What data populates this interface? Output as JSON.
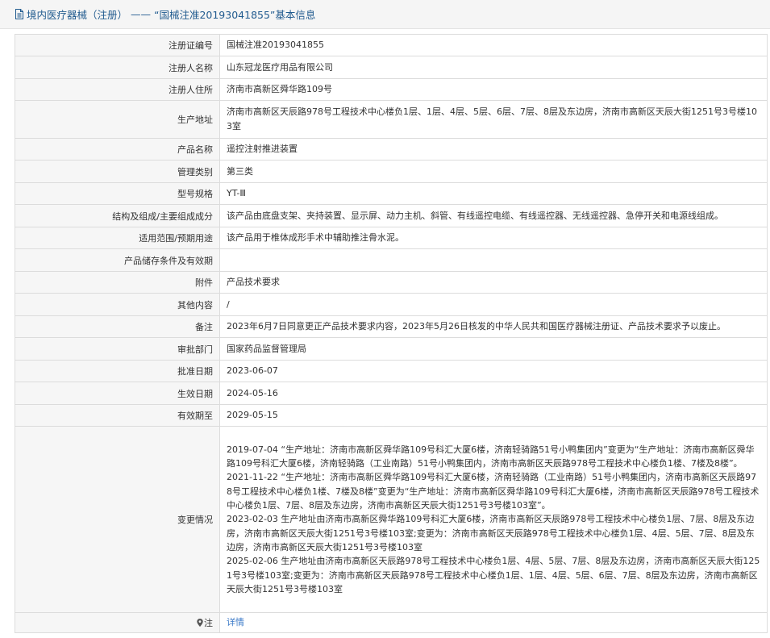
{
  "header": {
    "section": "境内医疗器械（注册）",
    "separator": " —— ",
    "record_title": "“国械注准20193041855”基本信息"
  },
  "rows": [
    {
      "label": "注册证编号",
      "value": "国械注准20193041855"
    },
    {
      "label": "注册人名称",
      "value": "山东冠龙医疗用品有限公司"
    },
    {
      "label": "注册人住所",
      "value": "济南市高新区舜华路109号"
    },
    {
      "label": "生产地址",
      "value": "济南市高新区天辰路978号工程技术中心楼负1层、1层、4层、5层、6层、7层、8层及东边房，济南市高新区天辰大街1251号3号楼103室"
    },
    {
      "label": "产品名称",
      "value": "遥控注射推进装置"
    },
    {
      "label": "管理类别",
      "value": "第三类"
    },
    {
      "label": "型号规格",
      "value": "YT-Ⅲ"
    },
    {
      "label": "结构及组成/主要组成成分",
      "value": "该产品由底盘支架、夹持装置、显示屏、动力主机、斜管、有线遥控电缆、有线遥控器、无线遥控器、急停开关和电源线组成。"
    },
    {
      "label": "适用范围/预期用途",
      "value": "该产品用于椎体成形手术中辅助推注骨水泥。"
    },
    {
      "label": "产品储存条件及有效期",
      "value": ""
    },
    {
      "label": "附件",
      "value": "产品技术要求"
    },
    {
      "label": "其他内容",
      "value": "/"
    },
    {
      "label": "备注",
      "value": "2023年6月7日同意更正产品技术要求内容，2023年5月26日核发的中华人民共和国医疗器械注册证、产品技术要求予以废止。"
    },
    {
      "label": "审批部门",
      "value": "国家药品监督管理局"
    },
    {
      "label": "批准日期",
      "value": "2023-06-07"
    },
    {
      "label": "生效日期",
      "value": "2024-05-16"
    },
    {
      "label": "有效期至",
      "value": "2029-05-15"
    }
  ],
  "changes": {
    "label": "变更情况",
    "entries": [
      "2019-07-04 “生产地址：济南市高新区舜华路109号科汇大厦6楼，济南轻骑路51号小鸭集团内”变更为“生产地址：济南市高新区舜华路109号科汇大厦6楼，济南轻骑路（工业南路）51号小鸭集团内，济南市高新区天辰路978号工程技术中心楼负1楼、7楼及8楼”。",
      "2021-11-22 “生产地址：济南市高新区舜华路109号科汇大厦6楼，济南轻骑路（工业南路）51号小鸭集团内，济南市高新区天辰路978号工程技术中心楼负1楼、7楼及8楼”变更为“生产地址：济南市高新区舜华路109号科汇大厦6楼，济南市高新区天辰路978号工程技术中心楼负1层、7层、8层及东边房，济南市高新区天辰大街1251号3号楼103室”。",
      "2023-02-03 生产地址由济南市高新区舜华路109号科汇大厦6楼，济南市高新区天辰路978号工程技术中心楼负1层、7层、8层及东边房，济南市高新区天辰大街1251号3号楼103室;变更为：济南市高新区天辰路978号工程技术中心楼负1层、4层、5层、7层、8层及东边房，济南市高新区天辰大街1251号3号楼103室",
      "2025-02-06 生产地址由济南市高新区天辰路978号工程技术中心楼负1层、4层、5层、7层、8层及东边房，济南市高新区天辰大街1251号3号楼103室;变更为：济南市高新区天辰路978号工程技术中心楼负1层、1层、4层、5层、6层、7层、8层及东边房，济南市高新区天辰大街1251号3号楼103室"
    ]
  },
  "note": {
    "label": "注",
    "link_text": "详情"
  },
  "colors": {
    "header_text": "#215b8f",
    "label_bg": "#f6f6f6",
    "border": "#dcdcdc",
    "link": "#3a79c8"
  },
  "icons": {
    "header": "document-icon",
    "note": "map-pin-icon"
  }
}
